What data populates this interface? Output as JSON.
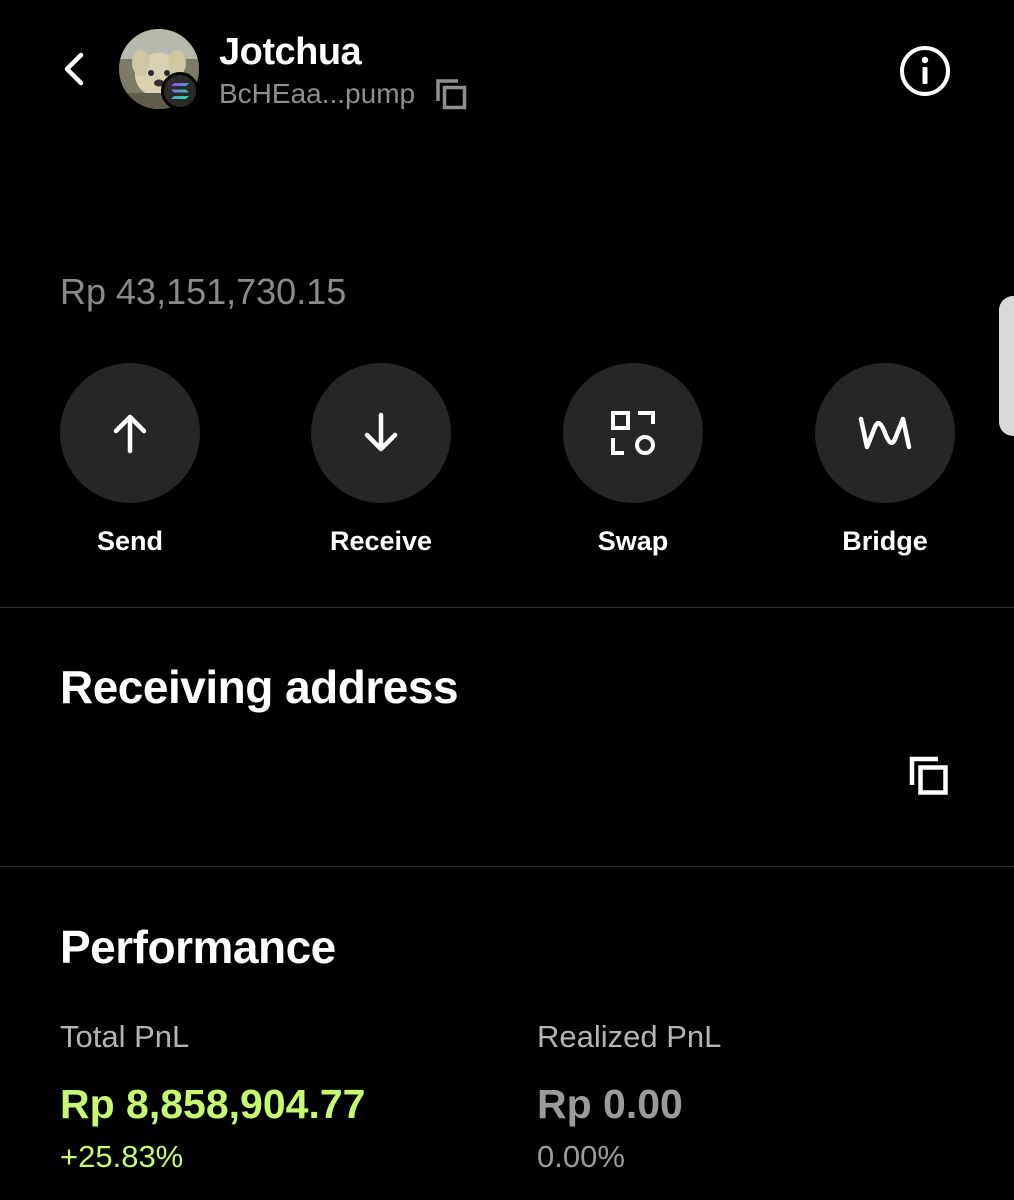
{
  "header": {
    "token_name": "Jotchua",
    "token_address": "BcHEaa...pump",
    "avatar_icon": "token-avatar-dog-icon",
    "chain_icon": "solana-chain-icon"
  },
  "balance": "Rp 43,151,730.15",
  "actions": [
    {
      "label": "Send",
      "icon": "arrow-up-icon"
    },
    {
      "label": "Receive",
      "icon": "arrow-down-icon"
    },
    {
      "label": "Swap",
      "icon": "swap-icon"
    },
    {
      "label": "Bridge",
      "icon": "bridge-icon"
    }
  ],
  "receiving_address": {
    "title": "Receiving address",
    "copy_icon": "copy-icon"
  },
  "performance": {
    "title": "Performance",
    "total_pnl": {
      "label": "Total PnL",
      "value": "Rp 8,858,904.77",
      "percent": "+25.83%",
      "color": "#c6fa6f"
    },
    "realized_pnl": {
      "label": "Realized PnL",
      "value": "Rp 0.00",
      "percent": "0.00%",
      "color": "#9b9b9b"
    }
  },
  "colors": {
    "background": "#000000",
    "button_bg": "#262626",
    "positive": "#c6fa6f",
    "muted": "#8a8a8a"
  }
}
